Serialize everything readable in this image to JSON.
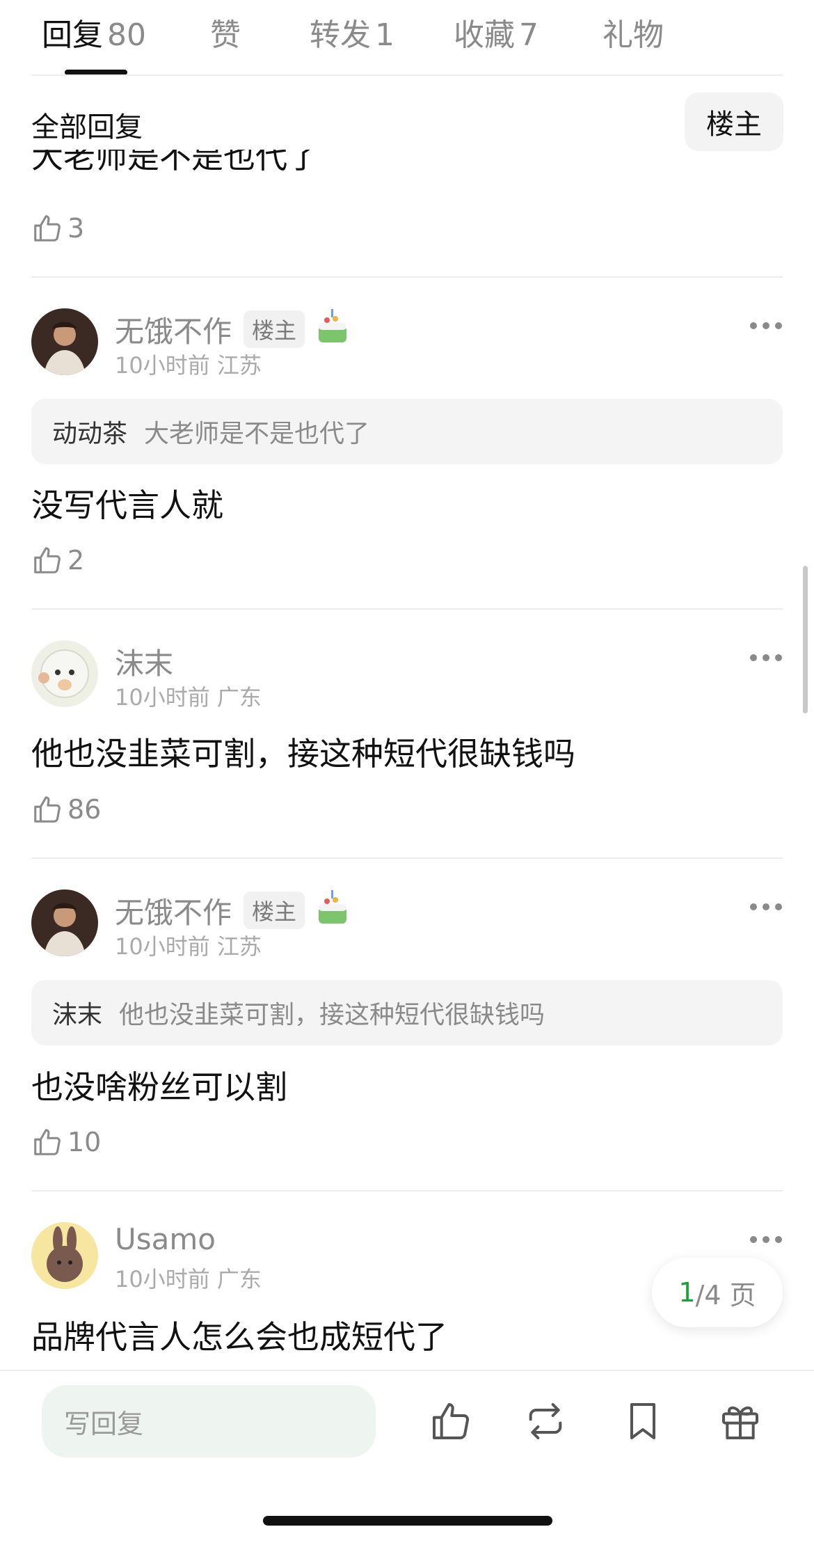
{
  "tabs": [
    {
      "label": "回复",
      "count": "80"
    },
    {
      "label": "赞",
      "count": ""
    },
    {
      "label": "转发",
      "count": "1"
    },
    {
      "label": "收藏",
      "count": "7"
    },
    {
      "label": "礼物",
      "count": ""
    }
  ],
  "section_title": "全部回复",
  "op_filter_label": "楼主",
  "partial_comment": {
    "text": "大老师是不是也代了",
    "likes": "3"
  },
  "comments": [
    {
      "user": "无饿不作",
      "badge": "楼主",
      "time": "10小时前",
      "location": "江苏",
      "quote_user": "动动茶",
      "quote_text": "大老师是不是也代了",
      "text": "没写代言人就",
      "likes": "2"
    },
    {
      "user": "沫末",
      "badge": "",
      "time": "10小时前",
      "location": "广东",
      "quote_user": "",
      "quote_text": "",
      "text": "他也没韭菜可割，接这种短代很缺钱吗",
      "likes": "86"
    },
    {
      "user": "无饿不作",
      "badge": "楼主",
      "time": "10小时前",
      "location": "江苏",
      "quote_user": "沫末",
      "quote_text": "他也没韭菜可割，接这种短代很缺钱吗",
      "text": "也没啥粉丝可以割",
      "likes": "10"
    },
    {
      "user": "Usamo",
      "badge": "",
      "time": "10小时前",
      "location": "广东",
      "quote_user": "",
      "quote_text": "",
      "text": "品牌代言人怎么会也成短代了",
      "likes": ""
    }
  ],
  "pager": {
    "current": "1",
    "total": "/4 页"
  },
  "bottom": {
    "reply_placeholder": "写回复"
  },
  "icons": [
    "thumbs-up-icon",
    "more-icon",
    "cake-icon",
    "repost-icon",
    "bookmark-icon",
    "gift-icon"
  ],
  "colors": {
    "accent": "#1e9e3a",
    "muted": "#8a8a8a"
  }
}
